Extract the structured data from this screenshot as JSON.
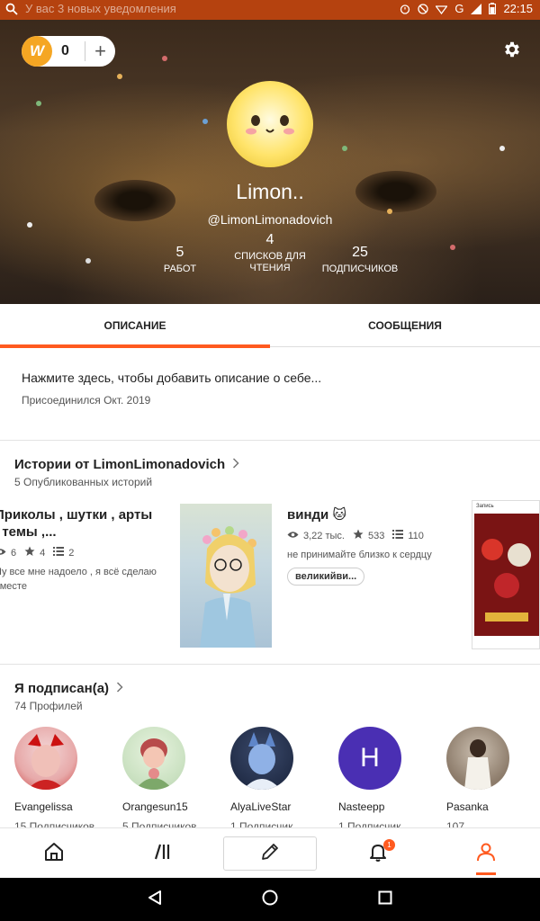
{
  "status_bar": {
    "notification_text": "У вас 3 новых уведомления",
    "carrier": "G",
    "time": "22:15"
  },
  "header": {
    "coins": "0",
    "coin_symbol": "W",
    "add_label": "+",
    "username": "Limon..",
    "handle": "@LimonLimonadovich",
    "stats": [
      {
        "num": "5",
        "label": "РАБОТ"
      },
      {
        "num": "4",
        "label": "СПИСКОВ ДЛЯ ЧТЕНИЯ"
      },
      {
        "num": "25",
        "label": "ПОДПИСЧИКОВ"
      }
    ]
  },
  "tabs": [
    {
      "label": "ОПИСАНИЕ",
      "active": true
    },
    {
      "label": "СООБЩЕНИЯ",
      "active": false
    }
  ],
  "about": {
    "prompt": "Нажмите здесь, чтобы добавить описание о себе...",
    "joined": "Присоединился Окт. 2019"
  },
  "stories": {
    "title": "Истории от LimonLimonadovich",
    "subtitle": "5 Опубликованных историй",
    "items": [
      {
        "title": "Приколы , шутки , арты , темы ,...",
        "views": "6",
        "votes": "4",
        "parts": "2",
        "description": "Ну все мне надоело , я всё сделаю вместе"
      },
      {
        "title": "винди 🐱",
        "views": "3,22 тыс.",
        "votes": "533",
        "parts": "110",
        "description": "не принимайте близко к сердцу",
        "tag": "великийви..."
      }
    ],
    "third_cover_label": "Запись"
  },
  "following": {
    "title": "Я подписан(а)",
    "subtitle": "74 Профилей",
    "items": [
      {
        "name": "Evangelissa",
        "followers": "15 Подписчиков"
      },
      {
        "name": "Orangesun15",
        "followers": "5 Подписчиков"
      },
      {
        "name": "AlyaLiveStar",
        "followers": "1 Подписчик"
      },
      {
        "name": "Nasteepp",
        "followers": "1 Подписчик",
        "initial": "H"
      },
      {
        "name": "Pasanka",
        "followers": "107"
      }
    ]
  },
  "bottom_nav": {
    "notification_badge": "1"
  },
  "colors": {
    "accent": "#ff5a1f",
    "status_bar": "#b5420f",
    "coin": "#f5a623",
    "avatar_purple": "#4a2fb3"
  }
}
